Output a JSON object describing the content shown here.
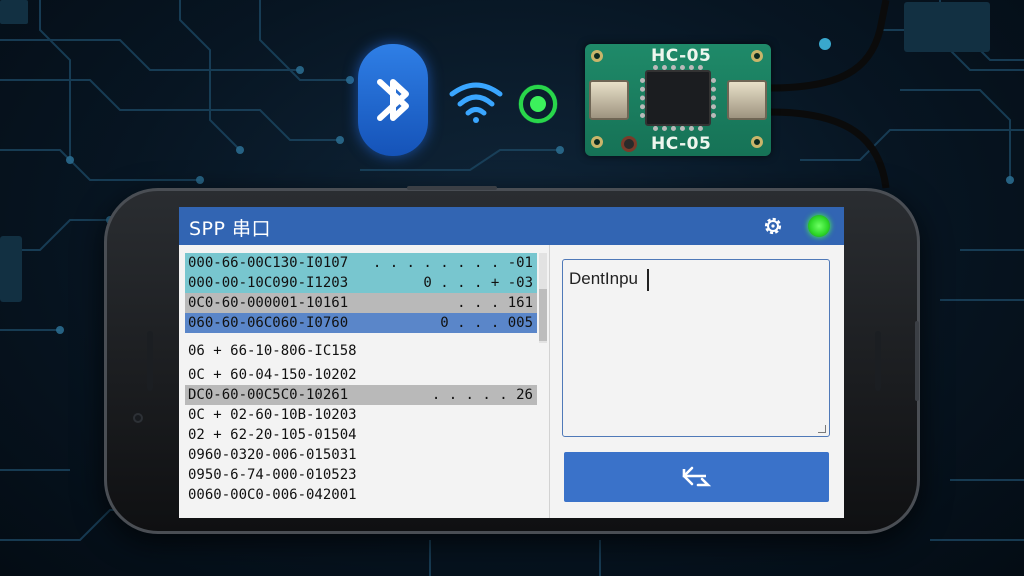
{
  "app": {
    "title": "SPP  串口",
    "connection_indicator_color": "#2fd92a",
    "settings_icon": "gear-icon"
  },
  "module": {
    "label_top": "HC-05",
    "label_bottom": "HC-05"
  },
  "colors": {
    "appbar": "#3265b3",
    "row_teal": "#78c6cf",
    "row_grey": "#b9b9b9",
    "row_blue": "#5a86c9",
    "send_button": "#3a72c9"
  },
  "log": {
    "rows": [
      {
        "left": "000-66-00C130-I0107",
        "right": ". . . . . . . . -01",
        "style": "teal"
      },
      {
        "left": "000-00-10C090-I1203",
        "right": "0 . . . + -03",
        "style": "teal"
      },
      {
        "left": "0C0-60-000001-10161",
        "right": ". . . 161",
        "style": "grey"
      },
      {
        "left": "060-60-06C060-I0760",
        "right": "0 . . . 005",
        "style": "blue"
      },
      {
        "left": "06 + 66-10-806-IC158",
        "right": "",
        "style": "plain"
      },
      {
        "left": "0C + 60-04-150-10202",
        "right": "",
        "style": "plain"
      },
      {
        "left": "DC0-60-00C5C0-10261",
        "right": ". . . . . 26",
        "style": "grey"
      },
      {
        "left": "0C + 02-60-10B-10203",
        "right": "",
        "style": "plain"
      },
      {
        "left": "02 + 62-20-105-01504",
        "right": "",
        "style": "plain"
      },
      {
        "left": "0960-0320-006-015031",
        "right": "",
        "style": "plain"
      },
      {
        "left": "0950-6-74-000-010523",
        "right": "",
        "style": "plain"
      },
      {
        "left": "0060-00C0-006-042001",
        "right": "",
        "style": "plain"
      }
    ]
  },
  "input": {
    "value": "DentInpu"
  },
  "send": {
    "icon": "send-arrow-icon"
  }
}
